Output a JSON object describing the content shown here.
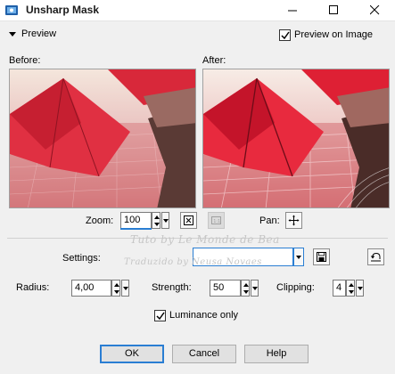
{
  "window": {
    "title": "Unsharp Mask",
    "icon": "psp-app-icon",
    "controls": [
      "minimize-icon",
      "maximize-icon",
      "close-icon"
    ]
  },
  "preview": {
    "toggle_label": "Preview",
    "preview_on_image_label": "Preview on Image",
    "preview_on_image_checked": true,
    "before_label": "Before:",
    "after_label": "After:"
  },
  "zoom": {
    "label": "Zoom:",
    "value": "100",
    "pan_label": "Pan:"
  },
  "settings": {
    "label": "Settings:",
    "value": ""
  },
  "params": {
    "radius_label": "Radius:",
    "radius_value": "4,00",
    "strength_label": "Strength:",
    "strength_value": "50",
    "clipping_label": "Clipping:",
    "clipping_value": "4",
    "luminance_label": "Luminance only",
    "luminance_checked": true
  },
  "buttons": {
    "ok": "OK",
    "cancel": "Cancel",
    "help": "Help"
  },
  "watermark": {
    "line1": "Tuto by Le Monde de Bea",
    "line2": "Traduzido by Neusa Novaes"
  },
  "colors": {
    "accent": "#2a7ed3",
    "umbrella_red": "#d8283a",
    "scene_pink": "#e8b4b8"
  }
}
